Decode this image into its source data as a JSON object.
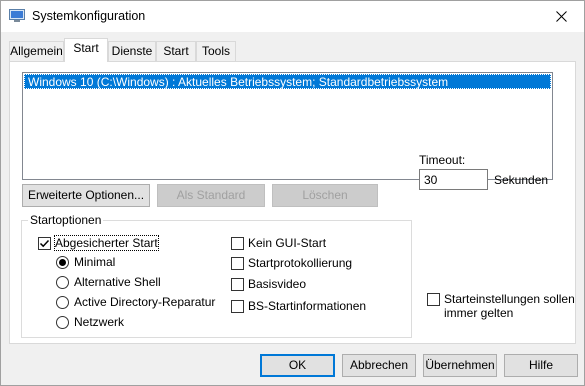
{
  "window": {
    "title": "Systemkonfiguration"
  },
  "tabs": [
    {
      "label": "Allgemein"
    },
    {
      "label": "Start"
    },
    {
      "label": "Dienste"
    },
    {
      "label": "Start"
    },
    {
      "label": "Tools"
    }
  ],
  "boot_list": {
    "items": [
      "Windows 10 (C:\\Windows) : Aktuelles Betriebssystem; Standardbetriebssystem"
    ]
  },
  "boot_buttons": {
    "advanced": "Erweiterte Optionen...",
    "set_default": "Als Standard",
    "delete": "Löschen"
  },
  "startoptions": {
    "title": "Startoptionen",
    "safe_boot": {
      "label": "Abgesicherter Start",
      "checked": true
    },
    "radios": [
      {
        "label": "Minimal",
        "selected": true
      },
      {
        "label": "Alternative Shell",
        "selected": false
      },
      {
        "label": "Active Directory-Reparatur",
        "selected": false
      },
      {
        "label": "Netzwerk",
        "selected": false
      }
    ],
    "checkboxes": [
      {
        "label": "Kein GUI-Start",
        "checked": false
      },
      {
        "label": "Startprotokollierung",
        "checked": false
      },
      {
        "label": "Basisvideo",
        "checked": false
      },
      {
        "label": "BS-Startinformationen",
        "checked": false
      }
    ]
  },
  "timeout": {
    "label": "Timeout:",
    "value": "30",
    "unit": "Sekunden"
  },
  "persist": {
    "label_line1": "Starteinstellungen sollen",
    "label_line2": "immer gelten",
    "checked": false
  },
  "footer": {
    "ok": "OK",
    "cancel": "Abbrechen",
    "apply": "Übernehmen",
    "help": "Hilfe"
  },
  "colors": {
    "selection": "#0078d7",
    "panel": "#ffffff",
    "chrome": "#f0f0f0"
  }
}
